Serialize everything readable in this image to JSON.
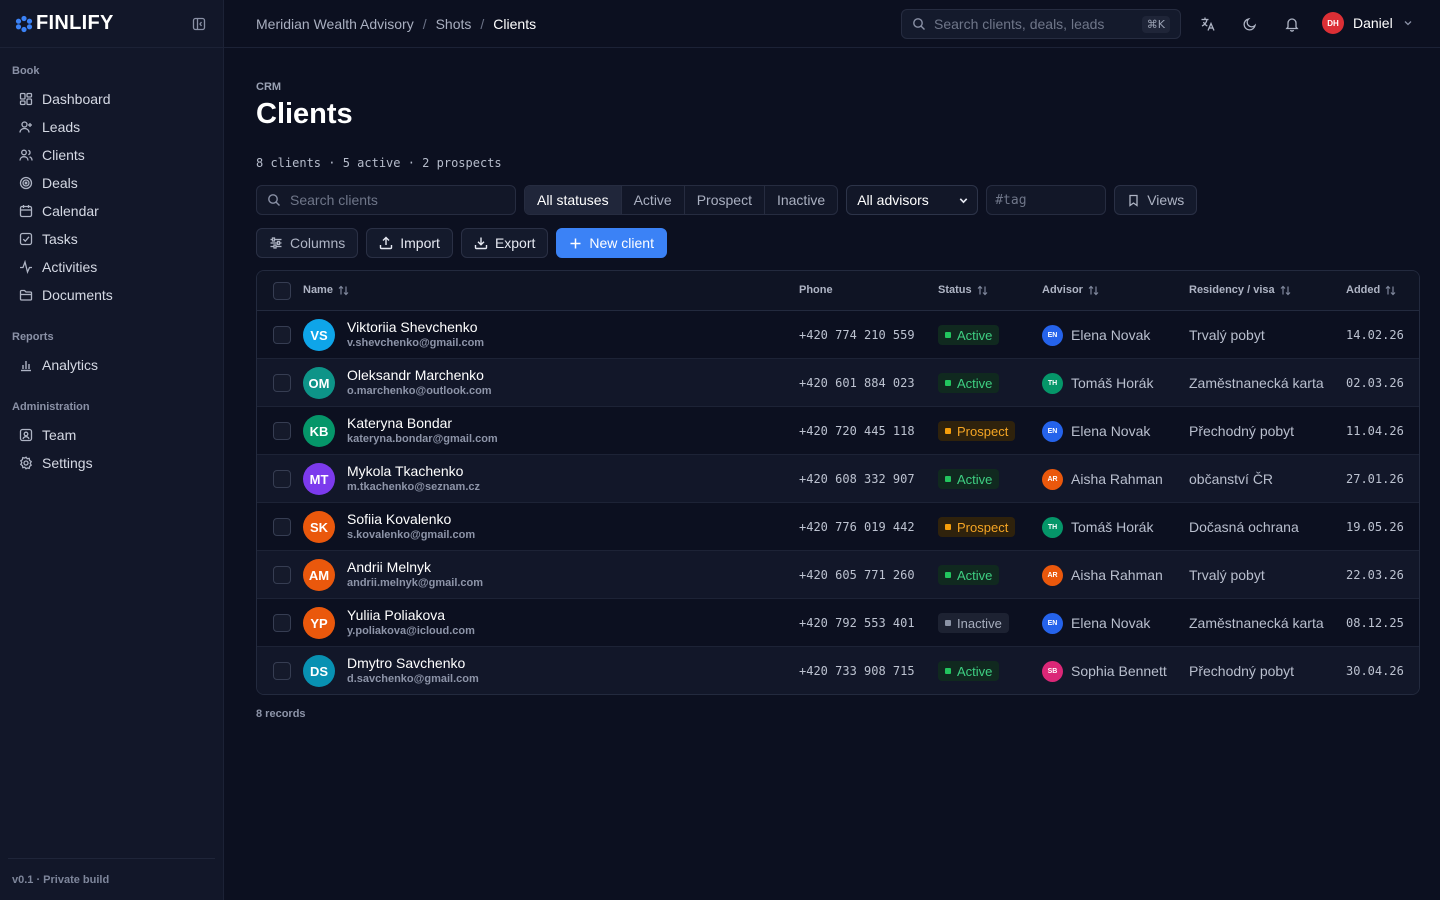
{
  "brand": {
    "name": "FINLIFY",
    "accent": "#3b82f6"
  },
  "sidebar": {
    "sections": [
      {
        "label": "Book",
        "items": [
          {
            "label": "Dashboard",
            "icon": "dashboard-icon"
          },
          {
            "label": "Leads",
            "icon": "user-plus-icon"
          },
          {
            "label": "Clients",
            "icon": "users-icon"
          },
          {
            "label": "Deals",
            "icon": "target-icon"
          },
          {
            "label": "Calendar",
            "icon": "calendar-icon"
          },
          {
            "label": "Tasks",
            "icon": "checkbox-icon"
          },
          {
            "label": "Activities",
            "icon": "activity-icon"
          },
          {
            "label": "Documents",
            "icon": "folder-icon"
          }
        ]
      },
      {
        "label": "Reports",
        "items": [
          {
            "label": "Analytics",
            "icon": "bar-chart-icon"
          }
        ]
      },
      {
        "label": "Administration",
        "items": [
          {
            "label": "Team",
            "icon": "id-card-icon"
          },
          {
            "label": "Settings",
            "icon": "gear-icon"
          }
        ]
      }
    ],
    "footer": "v0.1 · Private build"
  },
  "topbar": {
    "breadcrumbs": [
      "Meridian Wealth Advisory",
      "Shots",
      "Clients"
    ],
    "search_placeholder": "Search clients, deals, leads",
    "search_shortcut": "⌘K",
    "user": {
      "initials": "DH",
      "name": "Daniel"
    }
  },
  "page": {
    "eyebrow": "CRM",
    "title": "Clients",
    "summary": "8 clients · 5 active · 2 prospects"
  },
  "filters": {
    "search_placeholder": "Search clients",
    "statuses": [
      "All statuses",
      "Active",
      "Prospect",
      "Inactive"
    ],
    "selected_status": "All statuses",
    "advisor_select": "All advisors",
    "tag_placeholder": "#tag",
    "views_label": "Views"
  },
  "toolbar": {
    "columns_label": "Columns",
    "import_label": "Import",
    "export_label": "Export",
    "new_client_label": "New client"
  },
  "table": {
    "columns": {
      "name": "Name",
      "phone": "Phone",
      "status": "Status",
      "advisor": "Advisor",
      "residency": "Residency / visa",
      "added": "Added"
    },
    "rows": [
      {
        "initials": "VS",
        "avatar_color": "#0ea5e9",
        "name": "Viktoriia Shevchenko",
        "email": "v.shevchenko@gmail.com",
        "phone": "+420 774 210 559",
        "status": "Active",
        "advisor_initials": "EN",
        "advisor_color": "#2563eb",
        "advisor": "Elena Novak",
        "residency": "Trvalý pobyt",
        "added": "14.02.26"
      },
      {
        "initials": "OM",
        "avatar_color": "#0d9488",
        "name": "Oleksandr Marchenko",
        "email": "o.marchenko@outlook.com",
        "phone": "+420 601 884 023",
        "status": "Active",
        "advisor_initials": "TH",
        "advisor_color": "#059669",
        "advisor": "Tomáš Horák",
        "residency": "Zaměstnanecká karta",
        "added": "02.03.26"
      },
      {
        "initials": "KB",
        "avatar_color": "#059669",
        "name": "Kateryna Bondar",
        "email": "kateryna.bondar@gmail.com",
        "phone": "+420 720 445 118",
        "status": "Prospect",
        "advisor_initials": "EN",
        "advisor_color": "#2563eb",
        "advisor": "Elena Novak",
        "residency": "Přechodný pobyt",
        "added": "11.04.26"
      },
      {
        "initials": "MT",
        "avatar_color": "#7c3aed",
        "name": "Mykola Tkachenko",
        "email": "m.tkachenko@seznam.cz",
        "phone": "+420 608 332 907",
        "status": "Active",
        "advisor_initials": "AR",
        "advisor_color": "#ea580c",
        "advisor": "Aisha Rahman",
        "residency": "občanství ČR",
        "added": "27.01.26"
      },
      {
        "initials": "SK",
        "avatar_color": "#ea580c",
        "name": "Sofiia Kovalenko",
        "email": "s.kovalenko@gmail.com",
        "phone": "+420 776 019 442",
        "status": "Prospect",
        "advisor_initials": "TH",
        "advisor_color": "#059669",
        "advisor": "Tomáš Horák",
        "residency": "Dočasná ochrana",
        "added": "19.05.26"
      },
      {
        "initials": "AM",
        "avatar_color": "#ea580c",
        "name": "Andrii Melnyk",
        "email": "andrii.melnyk@gmail.com",
        "phone": "+420 605 771 260",
        "status": "Active",
        "advisor_initials": "AR",
        "advisor_color": "#ea580c",
        "advisor": "Aisha Rahman",
        "residency": "Trvalý pobyt",
        "added": "22.03.26"
      },
      {
        "initials": "YP",
        "avatar_color": "#ea580c",
        "name": "Yuliia Poliakova",
        "email": "y.poliakova@icloud.com",
        "phone": "+420 792 553 401",
        "status": "Inactive",
        "advisor_initials": "EN",
        "advisor_color": "#2563eb",
        "advisor": "Elena Novak",
        "residency": "Zaměstnanecká karta",
        "added": "08.12.25"
      },
      {
        "initials": "DS",
        "avatar_color": "#0891b2",
        "name": "Dmytro Savchenko",
        "email": "d.savchenko@gmail.com",
        "phone": "+420 733 908 715",
        "status": "Active",
        "advisor_initials": "SB",
        "advisor_color": "#db2777",
        "advisor": "Sophia Bennett",
        "residency": "Přechodný pobyt",
        "added": "30.04.26"
      }
    ],
    "footer": "8 records"
  }
}
